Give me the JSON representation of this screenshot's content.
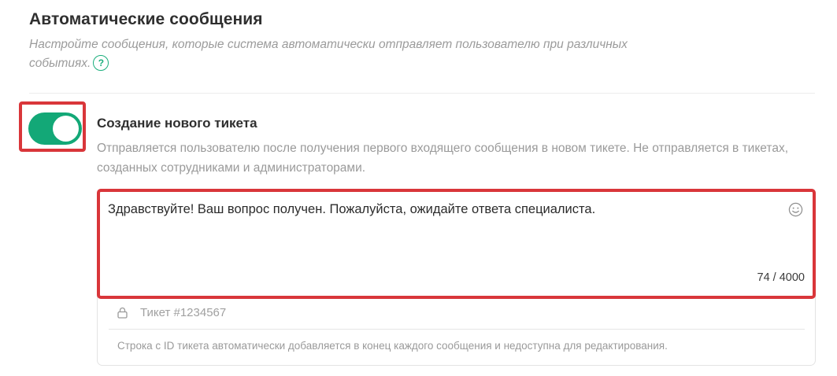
{
  "section": {
    "title": "Автоматические сообщения",
    "description": "Настройте сообщения, которые система автоматически отправляет пользователю при различных событиях.",
    "help_icon_label": "?"
  },
  "item": {
    "enabled": true,
    "title": "Создание нового тикета",
    "description": "Отправляется пользователю после получения первого входящего сообщения в новом тикете. Не отправляется в тикетах, созданных сотрудниками и администраторами."
  },
  "editor": {
    "message": "Здравствуйте! Ваш вопрос получен. Пожалуйста, ожидайте ответа специалиста.",
    "counter": "74 / 4000",
    "emoji_icon": "smile-icon"
  },
  "ticket": {
    "label": "Тикет #1234567",
    "lock_icon": "lock-icon",
    "hint": "Строка с ID тикета автоматически добавляется в конец каждого сообщения и недоступна для редактирования."
  },
  "colors": {
    "accent": "#13a877",
    "highlight": "#d9363a",
    "muted_text": "#9a9a9a"
  }
}
